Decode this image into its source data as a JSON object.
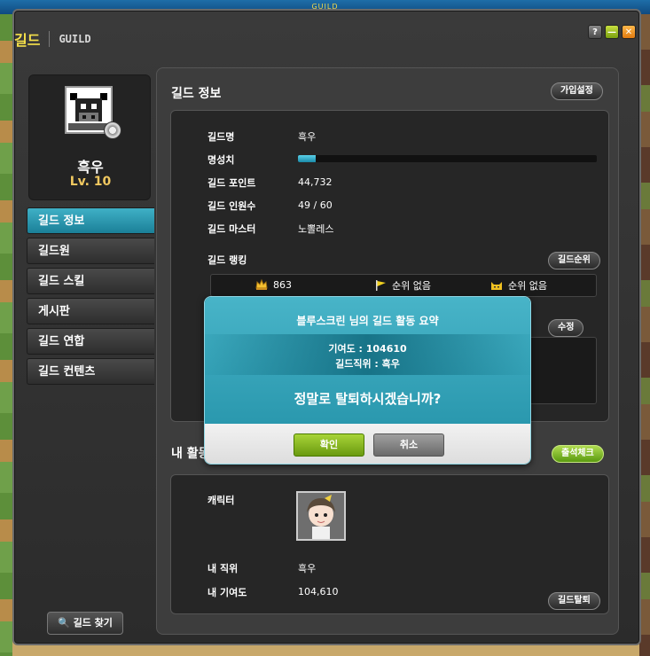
{
  "window": {
    "topbar_text": "GUILD",
    "title_ko": "길드",
    "title_en": "GUILD",
    "btn_help": "?",
    "btn_min": "—",
    "btn_close": "✕"
  },
  "profile": {
    "name": "흑우",
    "level": "Lv. 10"
  },
  "menu": {
    "items": [
      "길드 정보",
      "길드원",
      "길드 스킬",
      "게시판",
      "길드 연합",
      "길드 컨텐츠"
    ]
  },
  "find_guild": "길드 찾기",
  "guild_info": {
    "section_title": "길드 정보",
    "join_settings": "가입설정",
    "rows": [
      {
        "label": "길드명",
        "value": "흑우"
      },
      {
        "label": "명성치",
        "value": ""
      },
      {
        "label": "길드 포인트",
        "value": "44,732"
      },
      {
        "label": "길드 인원수",
        "value": "49 / 60"
      },
      {
        "label": "길드 마스터",
        "value": "노뽈레스"
      }
    ],
    "fame_fraction": 0.06,
    "ranking_label": "길드 랭킹",
    "ranking_button": "길드순위",
    "ranking": [
      {
        "icon": "crown-icon",
        "value": "863"
      },
      {
        "icon": "flag-icon",
        "value": "순위 없음"
      },
      {
        "icon": "cat-icon",
        "value": "순위 없음"
      }
    ],
    "edit_button": "수정"
  },
  "my_activity": {
    "section_title": "내 활동",
    "checkin_button": "출석체크",
    "character_label": "캐릭터",
    "position_label": "내 직위",
    "position_value": "흑우",
    "contribution_label": "내 기여도",
    "contribution_value": "104,610",
    "leave_button": "길드탈퇴"
  },
  "dialog": {
    "title": "블루스크린   님의 길드 활동 요약",
    "contribution_line": "기여도 :   104610",
    "position_line": "길드직위 :   흑우",
    "question": "정말로 탈퇴하시겠습니까?",
    "confirm": "확인",
    "cancel": "취소"
  },
  "colors": {
    "accent_teal": "#2a98ae",
    "title_yellow": "#f5e04a",
    "level_gold": "#f0c860",
    "confirm_green": "#8bc020"
  }
}
